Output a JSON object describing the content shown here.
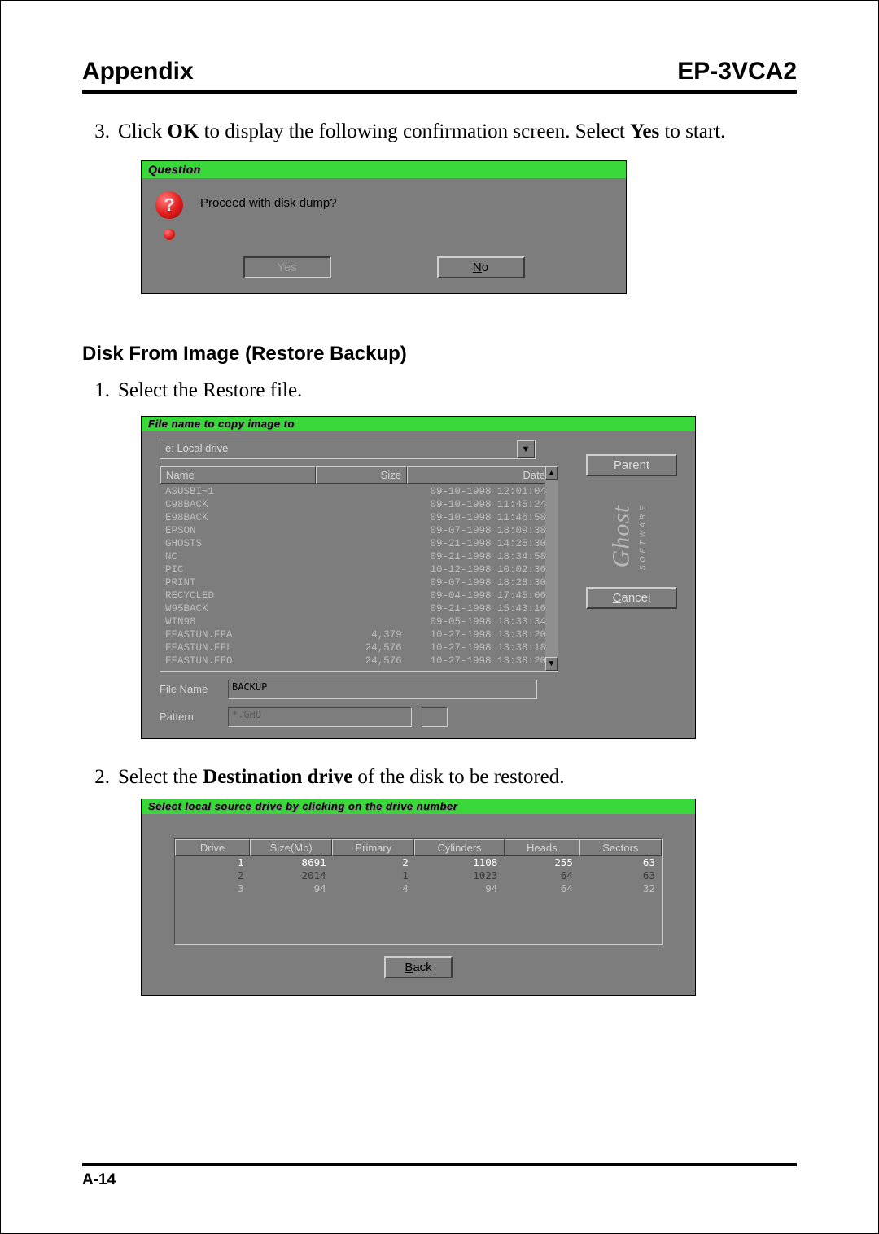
{
  "header": {
    "left": "Appendix",
    "right": "EP-3VCA2"
  },
  "step3": {
    "num": "3.",
    "pre": "Click ",
    "b1": "OK",
    "mid": " to display the following confirmation screen.  Select ",
    "b2": "Yes",
    "post": " to start."
  },
  "questionDlg": {
    "title": "Question",
    "msg": "Proceed with disk dump?",
    "yes": "Yes",
    "noPrefix": "N",
    "noRest": "o"
  },
  "sectH": "Disk From Image (Restore Backup)",
  "step1": {
    "num": "1.",
    "txt": "Select the Restore file."
  },
  "fileDlg": {
    "title": "File name to copy image to",
    "drive": "e: Local drive",
    "cols": {
      "name": "Name",
      "size": "Size",
      "date": "Date"
    },
    "rows": [
      {
        "name": "ASUSBI~1",
        "size": "",
        "date": "09-10-1998 12:01:04"
      },
      {
        "name": "C98BACK",
        "size": "",
        "date": "09-10-1998 11:45:24"
      },
      {
        "name": "E98BACK",
        "size": "",
        "date": "09-10-1998 11:46:58"
      },
      {
        "name": "EPSON",
        "size": "",
        "date": "09-07-1998 18:09:38"
      },
      {
        "name": "GHOSTS",
        "size": "",
        "date": "09-21-1998 14:25:30"
      },
      {
        "name": "NC",
        "size": "",
        "date": "09-21-1998 18:34:58"
      },
      {
        "name": "PIC",
        "size": "",
        "date": "10-12-1998 10:02:36"
      },
      {
        "name": "PRINT",
        "size": "",
        "date": "09-07-1998 18:28:30"
      },
      {
        "name": "RECYCLED",
        "size": "",
        "date": "09-04-1998 17:45:06"
      },
      {
        "name": "W95BACK",
        "size": "",
        "date": "09-21-1998 15:43:16"
      },
      {
        "name": "WIN98",
        "size": "",
        "date": "09-05-1998 18:33:34"
      },
      {
        "name": "FFASTUN.FFA",
        "size": "4,379",
        "date": "10-27-1998 13:38:20"
      },
      {
        "name": "FFASTUN.FFL",
        "size": "24,576",
        "date": "10-27-1998 13:38:18"
      },
      {
        "name": "FFASTUN.FFO",
        "size": "24,576",
        "date": "10-27-1998 13:38:20"
      }
    ],
    "parentP": "P",
    "parentRest": "arent",
    "cancelC": "C",
    "cancelRest": "ancel",
    "fileNameLbl": "File Name",
    "fileNameVal": "BACKUP",
    "patternLbl": "Pattern",
    "patternVal": "*.GHO",
    "logo": "Ghost",
    "logoSub": "SOFTWARE"
  },
  "step2": {
    "num": "2.",
    "pre": "Select the ",
    "b": "Destination drive",
    "post": " of the disk to be restored."
  },
  "driveDlg": {
    "title": "Select local source drive by clicking on the drive number",
    "cols": {
      "drive": "Drive",
      "size": "Size(Mb)",
      "primary": "Primary",
      "cyl": "Cylinders",
      "heads": "Heads",
      "sectors": "Sectors"
    },
    "rows": [
      {
        "drive": "1",
        "size": "8691",
        "primary": "2",
        "cyl": "1108",
        "heads": "255",
        "sectors": "63"
      },
      {
        "drive": "2",
        "size": "2014",
        "primary": "1",
        "cyl": "1023",
        "heads": "64",
        "sectors": "63"
      },
      {
        "drive": "3",
        "size": "94",
        "primary": "4",
        "cyl": "94",
        "heads": "64",
        "sectors": "32"
      }
    ],
    "backB": "B",
    "backRest": "ack"
  },
  "footer": {
    "page": "A-14"
  }
}
